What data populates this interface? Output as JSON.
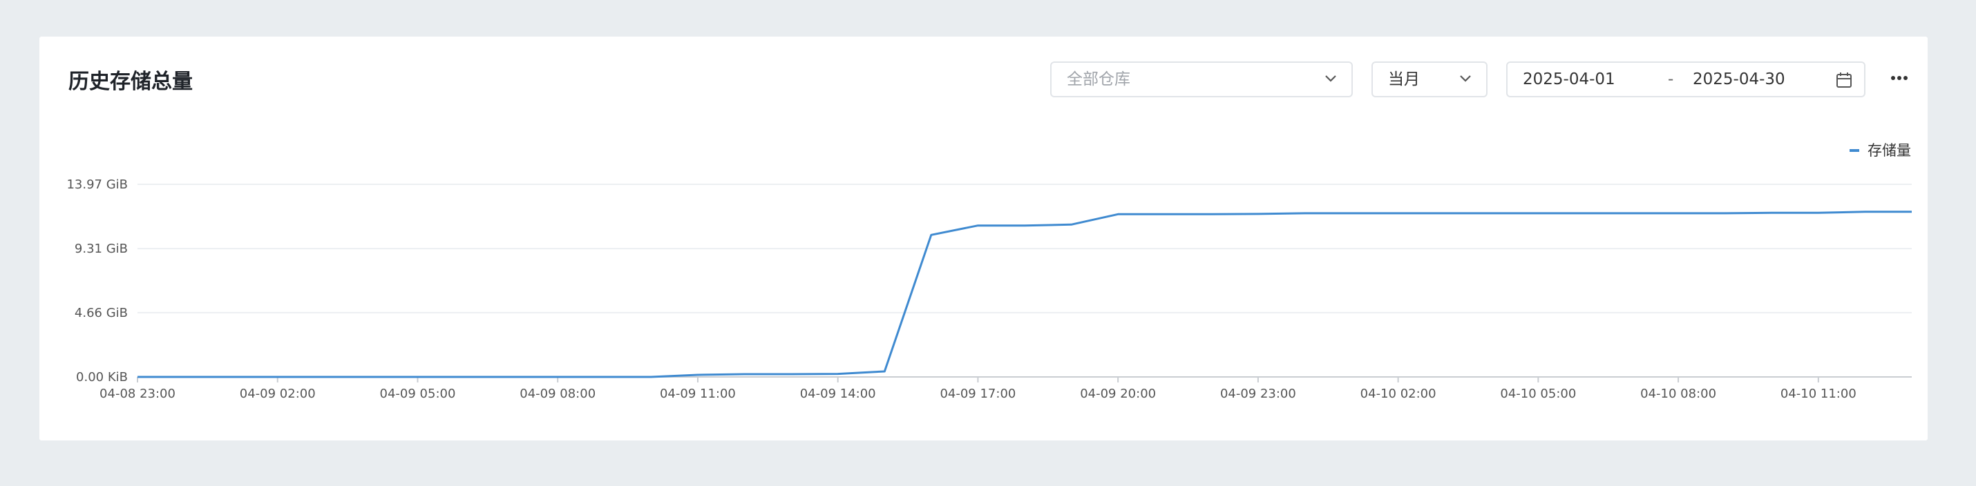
{
  "card": {
    "title": "历史存储总量",
    "warehouse_placeholder": "全部仓库",
    "period_value": "当月",
    "date_start": "2025-04-01",
    "date_sep": "-",
    "date_end": "2025-04-30"
  },
  "colors": {
    "series": "#3f8ad0",
    "grid": "#eceff2",
    "axis": "#c9cdd2"
  },
  "chart_data": {
    "type": "line",
    "title": "历史存储总量",
    "xlabel": "",
    "ylabel": "",
    "y_ticks": [
      "0.00 KiB",
      "4.66 GiB",
      "9.31 GiB",
      "13.97 GiB"
    ],
    "y_tick_values": [
      0,
      4.66,
      9.31,
      13.97
    ],
    "ylim": [
      0,
      13.97
    ],
    "y_unit": "GiB",
    "x_ticks": [
      "04-08 23:00",
      "04-09 02:00",
      "04-09 05:00",
      "04-09 08:00",
      "04-09 11:00",
      "04-09 14:00",
      "04-09 17:00",
      "04-09 20:00",
      "04-09 23:00",
      "04-10 02:00",
      "04-10 05:00",
      "04-10 08:00",
      "04-10 11:00"
    ],
    "x_tick_values": [
      0,
      3,
      6,
      9,
      12,
      15,
      18,
      21,
      24,
      27,
      30,
      33,
      36
    ],
    "xlim": [
      0,
      38
    ],
    "legend_position": "top-right",
    "series": [
      {
        "name": "存储量",
        "x": [
          0,
          3,
          6,
          9,
          11,
          12,
          13,
          14,
          15,
          16,
          17,
          18,
          19,
          20,
          21,
          22,
          23,
          24,
          25,
          26,
          27,
          28,
          29,
          30,
          31,
          32,
          33,
          34,
          35,
          36,
          37,
          38
        ],
        "y": [
          0,
          0,
          0,
          0,
          0,
          0.15,
          0.2,
          0.2,
          0.22,
          0.4,
          10.3,
          10.98,
          10.98,
          11.05,
          11.8,
          11.8,
          11.8,
          11.82,
          11.87,
          11.87,
          11.87,
          11.87,
          11.87,
          11.87,
          11.87,
          11.87,
          11.87,
          11.87,
          11.9,
          11.9,
          11.98,
          11.98
        ]
      }
    ]
  }
}
